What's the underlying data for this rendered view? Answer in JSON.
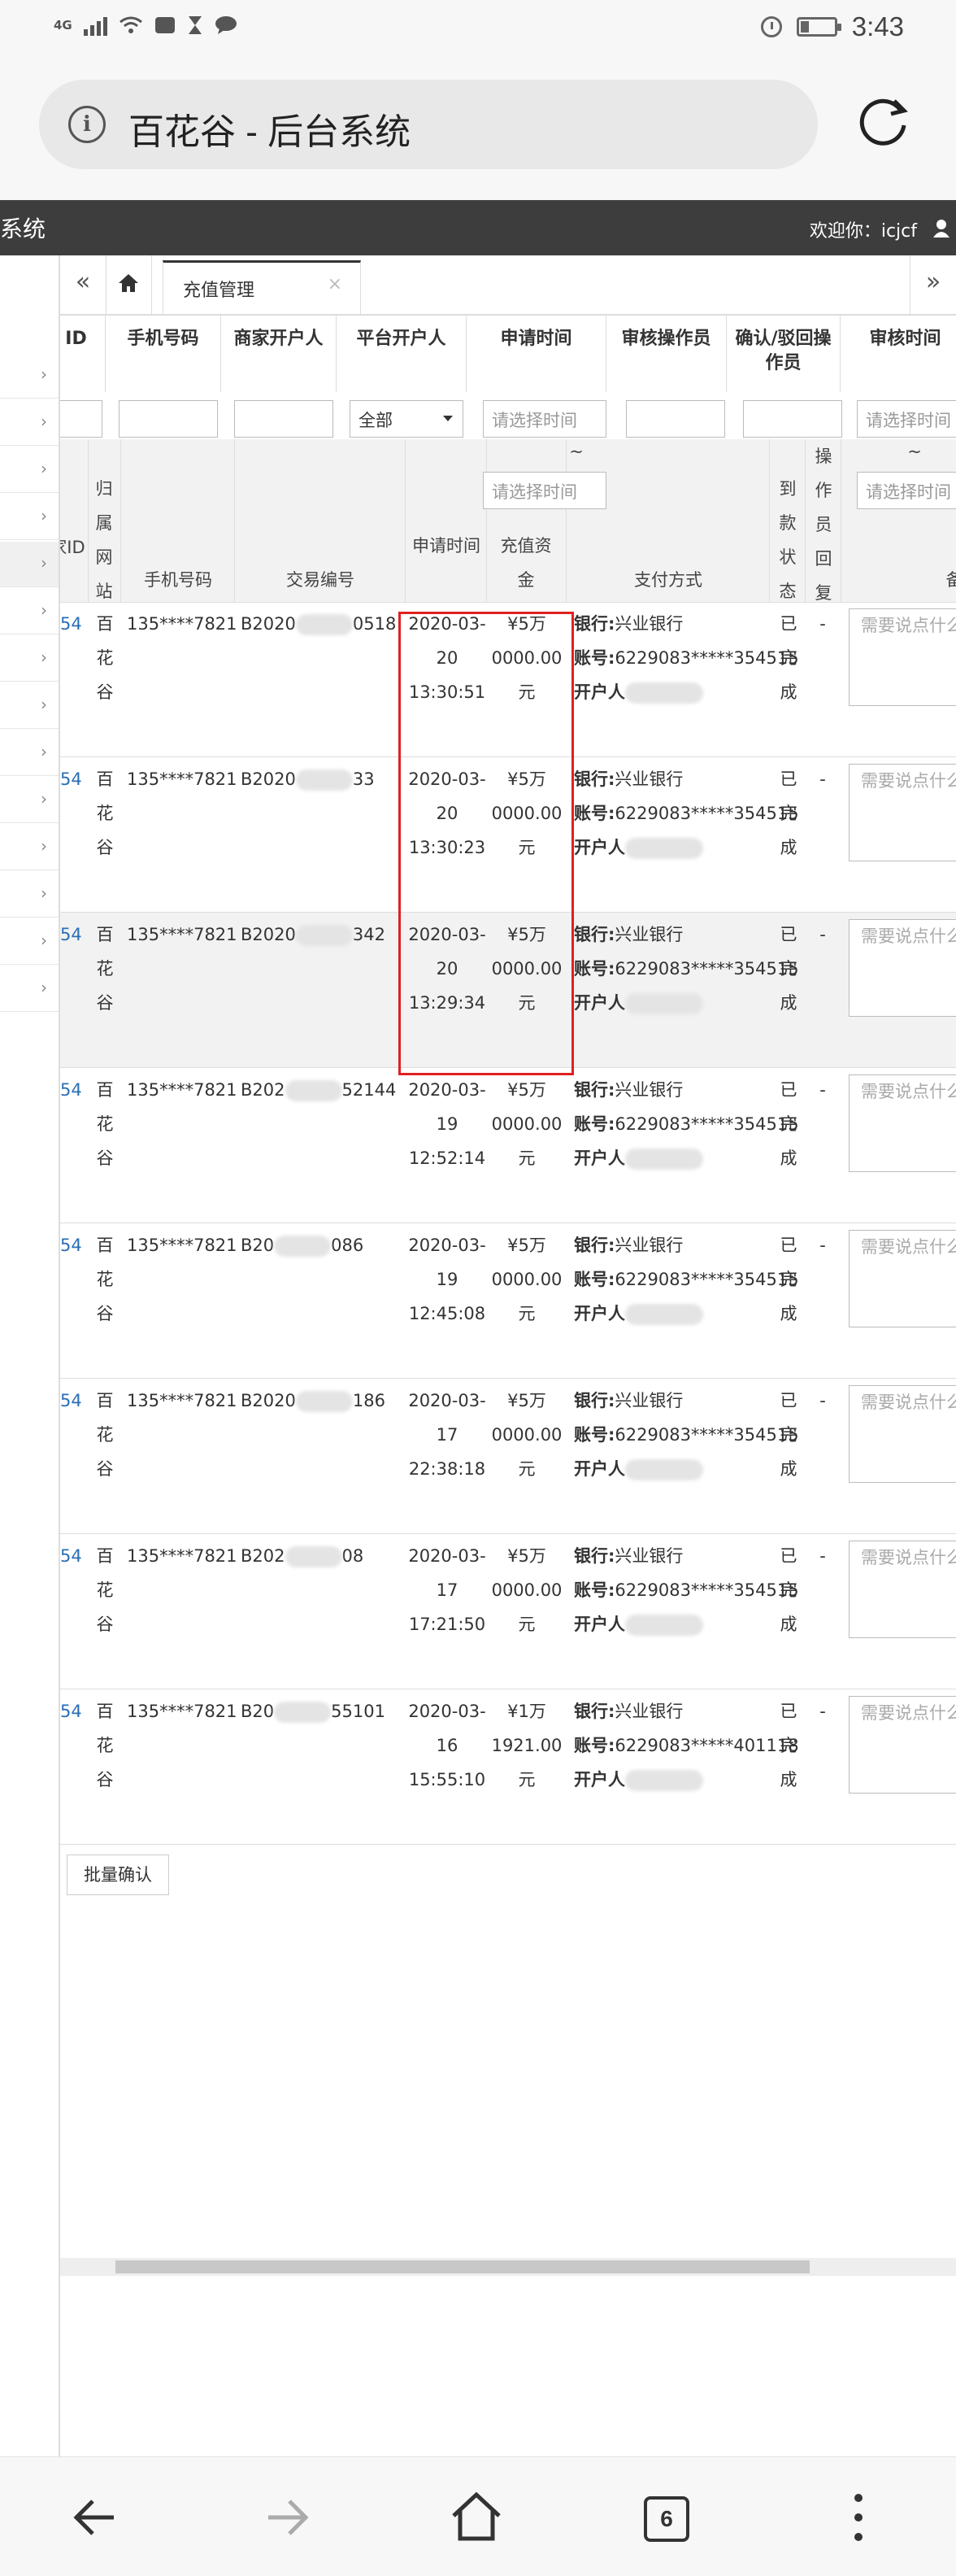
{
  "status_bar": {
    "network": "4G",
    "time": "3:43",
    "battery_level": 0.25
  },
  "browser": {
    "page_title": "百花谷 - 后台系统",
    "tab_count": "6"
  },
  "admin": {
    "brand": "系统",
    "welcome": "欢迎你：icjcf"
  },
  "tabs": {
    "active_label": "充值管理",
    "prev": "«",
    "next": "»"
  },
  "table": {
    "header_row1": {
      "id": "ID",
      "phone": "手机号码",
      "merchant_owner": "商家开户人",
      "platform_owner": "平台开户人",
      "apply_time": "申请时间",
      "reviewer": "审核操作员",
      "confirm_operator": "确认/驳回操作员",
      "review_time": "审核时间"
    },
    "filters": {
      "platform_select": "全部",
      "time_placeholder": "请选择时间",
      "tilde": "~"
    },
    "header_row3": {
      "merchant_id": "家ID",
      "site": "归属网站",
      "phone": "手机号码",
      "txn_no": "交易编号",
      "apply_time": "申请时间",
      "amount": "充值资金",
      "pay_method": "支付方式",
      "arrival_status": "到款状态",
      "operator_reply": "操作员回复",
      "note": "备"
    },
    "labels": {
      "bank": "银行:",
      "account": "账号:",
      "holder": "开户人"
    },
    "rows": [
      {
        "id": "54",
        "site": "百花谷",
        "phone": "135****7821",
        "txn": "B2020",
        "txn_tail": "0518",
        "date": "2020-03-20",
        "time": "13:30:51",
        "amount_l1": "¥5万",
        "amount_l2": "0000.00",
        "amount_l3": "元",
        "bank": "兴业银行",
        "account": "6229083*****354515",
        "status": "已完成",
        "op": "-",
        "note": "需要说点什么"
      },
      {
        "id": "54",
        "site": "百花谷",
        "phone": "135****7821",
        "txn": "B2020",
        "txn_tail": "33",
        "date": "2020-03-20",
        "time": "13:30:23",
        "amount_l1": "¥5万",
        "amount_l2": "0000.00",
        "amount_l3": "元",
        "bank": "兴业银行",
        "account": "6229083*****354515",
        "status": "已完成",
        "op": "-",
        "note": "需要说点什么"
      },
      {
        "id": "54",
        "site": "百花谷",
        "phone": "135****7821",
        "txn": "B2020",
        "txn_tail": "342",
        "date": "2020-03-20",
        "time": "13:29:34",
        "amount_l1": "¥5万",
        "amount_l2": "0000.00",
        "amount_l3": "元",
        "bank": "兴业银行",
        "account": "6229083*****354515",
        "status": "已完成",
        "op": "-",
        "note": "需要说点什么"
      },
      {
        "id": "54",
        "site": "百花谷",
        "phone": "135****7821",
        "txn": "B202",
        "txn_tail": "52144",
        "date": "2020-03-19",
        "time": "12:52:14",
        "amount_l1": "¥5万",
        "amount_l2": "0000.00",
        "amount_l3": "元",
        "bank": "兴业银行",
        "account": "6229083*****354515",
        "status": "已完成",
        "op": "-",
        "note": "需要说点什么"
      },
      {
        "id": "54",
        "site": "百花谷",
        "phone": "135****7821",
        "txn": "B20",
        "txn_tail": "086",
        "date": "2020-03-19",
        "time": "12:45:08",
        "amount_l1": "¥5万",
        "amount_l2": "0000.00",
        "amount_l3": "元",
        "bank": "兴业银行",
        "account": "6229083*****354515",
        "status": "已完成",
        "op": "-",
        "note": "需要说点什么"
      },
      {
        "id": "54",
        "site": "百花谷",
        "phone": "135****7821",
        "txn": "B2020",
        "txn_tail": "186",
        "date": "2020-03-17",
        "time": "22:38:18",
        "amount_l1": "¥5万",
        "amount_l2": "0000.00",
        "amount_l3": "元",
        "bank": "兴业银行",
        "account": "6229083*****354515",
        "status": "已完成",
        "op": "-",
        "note": "需要说点什么"
      },
      {
        "id": "54",
        "site": "百花谷",
        "phone": "135****7821",
        "txn": "B202",
        "txn_tail": "08",
        "date": "2020-03-17",
        "time": "17:21:50",
        "amount_l1": "¥5万",
        "amount_l2": "0000.00",
        "amount_l3": "元",
        "bank": "兴业银行",
        "account": "6229083*****354515",
        "status": "已完成",
        "op": "-",
        "note": "需要说点什么"
      },
      {
        "id": "54",
        "site": "百花谷",
        "phone": "135****7821",
        "txn": "B20",
        "txn_tail": "55101",
        "date": "2020-03-16",
        "time": "15:55:10",
        "amount_l1": "¥1万",
        "amount_l2": "1921.00",
        "amount_l3": "元",
        "bank": "兴业银行",
        "account": "6229083*****401118",
        "status": "已完成",
        "op": "-",
        "note": "需要说点什么"
      }
    ],
    "batch_confirm": "批量确认"
  },
  "colors": {
    "header_bg": "#3d3d3d",
    "link_blue": "#2a6fb6",
    "highlight_red": "#e02020",
    "row_highlight": "#f2f2f2"
  },
  "icons": [
    "info-icon",
    "reload-icon",
    "home-icon",
    "user-icon",
    "back-icon",
    "forward-icon",
    "home-nav-icon",
    "more-icon"
  ]
}
